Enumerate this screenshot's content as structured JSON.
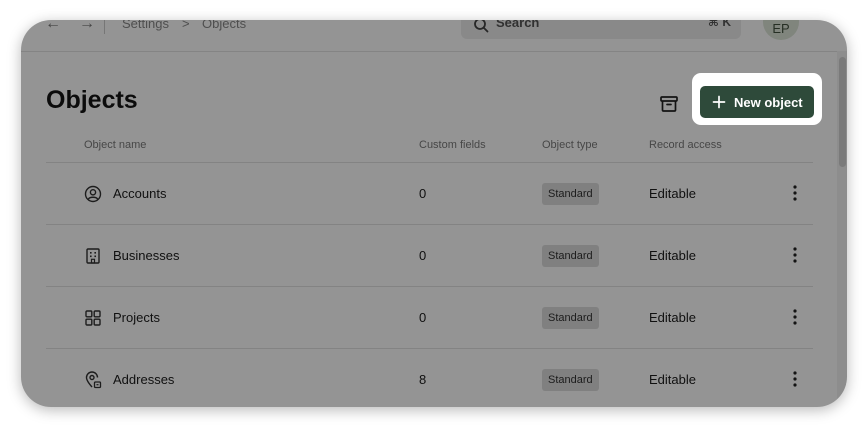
{
  "topbar": {
    "breadcrumb": [
      "Settings",
      "Objects"
    ],
    "breadcrumb_separator": ">",
    "search_label": "Search",
    "search_shortcut": "⌘ K",
    "avatar_initials": "EP"
  },
  "page": {
    "title": "Objects",
    "new_object_label": "New object"
  },
  "table": {
    "headers": [
      "Object name",
      "Custom fields",
      "Object type",
      "Record access"
    ],
    "rows": [
      {
        "icon": "user-circle-icon",
        "name": "Accounts",
        "custom_fields": "0",
        "type": "Standard",
        "access": "Editable"
      },
      {
        "icon": "building-icon",
        "name": "Businesses",
        "custom_fields": "0",
        "type": "Standard",
        "access": "Editable"
      },
      {
        "icon": "grid-icon",
        "name": "Projects",
        "custom_fields": "0",
        "type": "Standard",
        "access": "Editable"
      },
      {
        "icon": "map-pin-icon",
        "name": "Addresses",
        "custom_fields": "8",
        "type": "Standard",
        "access": "Editable"
      }
    ]
  },
  "colors": {
    "primary_button": "#2e4a3a",
    "overlay": "rgba(0,0,0,0.42)",
    "badge_bg": "#dcdcdc"
  }
}
